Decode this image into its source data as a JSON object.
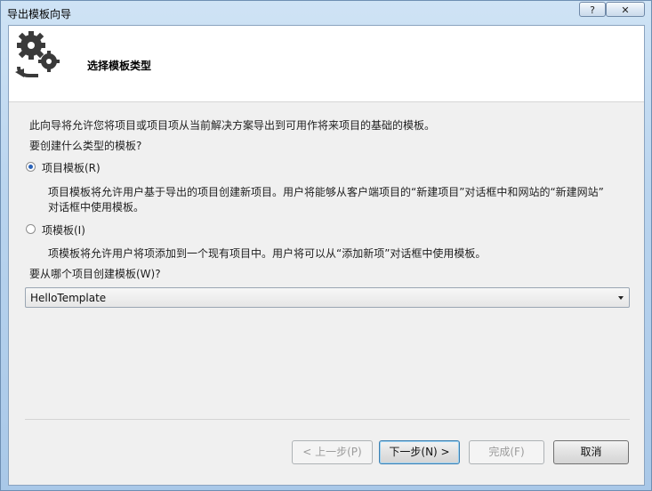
{
  "window": {
    "title": "导出模板向导"
  },
  "titlebar_buttons": {
    "help": "?",
    "close": "✕"
  },
  "header": {
    "title": "选择模板类型",
    "icon": "gears-export-icon"
  },
  "intro": {
    "description": "此向导将允许您将项目或项目项从当前解决方案导出到可用作将来项目的基础的模板。",
    "question": "要创建什么类型的模板?"
  },
  "options": {
    "project_template": {
      "label": "项目模板(R)",
      "selected": true,
      "desc_line1": "项目模板将允许用户基于导出的项目创建新项目。用户将能够从客户端项目的“新建项目”对话框中和网站的“新建网站”",
      "desc_line2": "对话框中使用模板。"
    },
    "item_template": {
      "label": "项模板(I)",
      "selected": false,
      "desc_line1": "项模板将允许用户将项添加到一个现有项目中。用户将可以从“添加新项”对话框中使用模板。"
    }
  },
  "project_select": {
    "label": "要从哪个项目创建模板(W)?",
    "value": "HelloTemplate"
  },
  "buttons": {
    "back": "< 上一步(P)",
    "next": "下一步(N) >",
    "finish": "完成(F)",
    "cancel": "取消"
  },
  "colors": {
    "accent": "#2a62b8",
    "client_bg": "#f0f0f0",
    "header_bg": "#ffffff"
  }
}
